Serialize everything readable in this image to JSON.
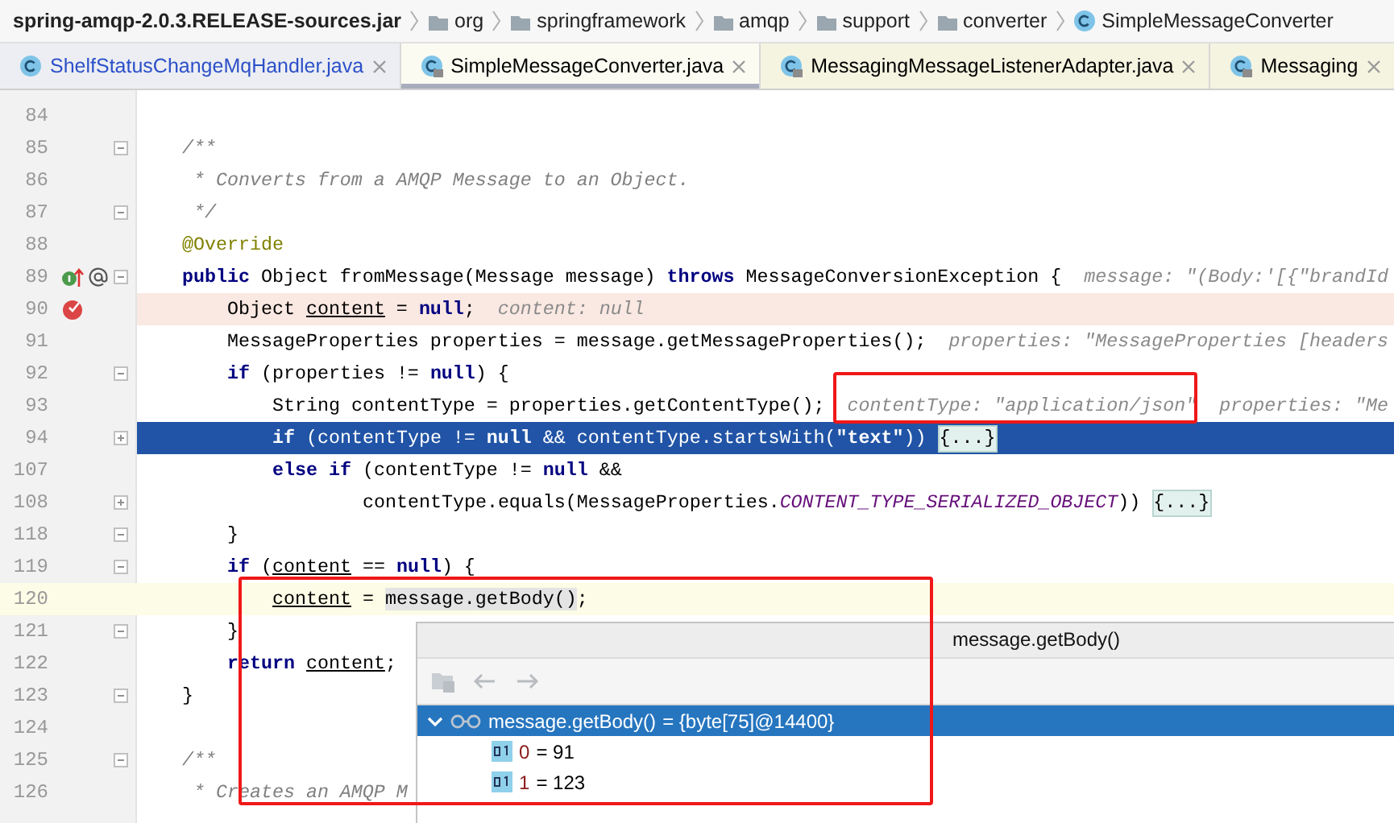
{
  "breadcrumbs": [
    {
      "kind": "jar",
      "label": "spring-amqp-2.0.3.RELEASE-sources.jar"
    },
    {
      "kind": "package",
      "label": "org"
    },
    {
      "kind": "package",
      "label": "springframework"
    },
    {
      "kind": "package",
      "label": "amqp"
    },
    {
      "kind": "package",
      "label": "support"
    },
    {
      "kind": "package",
      "label": "converter"
    },
    {
      "kind": "class",
      "label": "SimpleMessageConverter"
    }
  ],
  "tabs": [
    {
      "label": "ShelfStatusChangeMqHandler.java",
      "selected": false,
      "color": "#2c50c8",
      "library": false
    },
    {
      "label": "SimpleMessageConverter.java",
      "selected": true,
      "color": "#000000",
      "library": true
    },
    {
      "label": "MessagingMessageListenerAdapter.java",
      "selected": false,
      "color": "#000000",
      "library": true
    },
    {
      "label": "Messaging",
      "selected": false,
      "color": "#000000",
      "library": true
    }
  ],
  "editor": {
    "lines": [
      {
        "number": "84"
      },
      {
        "number": "85",
        "fold_marker": true,
        "collapsed": false,
        "segments": [
          {
            "kind": "comment",
            "s": "/**"
          }
        ]
      },
      {
        "number": "86",
        "segments": [
          {
            "kind": "comment",
            "s": " * Converts from a AMQP Message to an Object."
          }
        ]
      },
      {
        "number": "87",
        "fold_marker": true,
        "collapsed": false,
        "segments": [
          {
            "kind": "comment",
            "s": " */"
          }
        ]
      },
      {
        "number": "88",
        "segments": [
          {
            "kind": "annotation",
            "s": "@Override"
          }
        ]
      },
      {
        "number": "89",
        "fold_marker": true,
        "collapsed": false,
        "implements_marker": true,
        "annotation_marker": true,
        "segments": [
          {
            "kind": "keyword",
            "s": "public "
          },
          {
            "kind": "plain",
            "s": "Object fromMessage(Message message) "
          },
          {
            "kind": "keyword",
            "s": "throws "
          },
          {
            "kind": "plain",
            "s": "MessageConversionException {"
          },
          {
            "kind": "hint",
            "s": "message: \"(Body:'[{\"brandId"
          }
        ],
        "children": [
          {
            "number": "90",
            "breakpoint": true,
            "segments": [
              {
                "kind": "plain",
                "s": "Object "
              },
              {
                "kind": "variable",
                "s": "content"
              },
              {
                "kind": "plain",
                "s": " = "
              },
              {
                "kind": "keyword",
                "s": "null"
              },
              {
                "kind": "plain",
                "s": ";"
              },
              {
                "kind": "hint",
                "s": "content: null"
              }
            ]
          },
          {
            "number": "91",
            "segments": [
              {
                "kind": "plain",
                "s": "MessageProperties properties = message.getMessageProperties();"
              },
              {
                "kind": "hint",
                "s": "properties: \"MessageProperties [headers"
              }
            ]
          },
          {
            "number": "92",
            "fold_marker": true,
            "collapsed": false,
            "segments": [
              {
                "kind": "keyword",
                "s": "if "
              },
              {
                "kind": "plain",
                "s": "(properties != "
              },
              {
                "kind": "keyword",
                "s": "null"
              },
              {
                "kind": "plain",
                "s": ") {"
              }
            ],
            "children": [
              {
                "number": "93",
                "segments": [
                  {
                    "kind": "plain",
                    "s": "String contentType = properties.getContentType();"
                  },
                  {
                    "kind": "hint",
                    "s": "contentType: \"application/json\""
                  },
                  {
                    "kind": "hint",
                    "s": "properties: \"Me"
                  }
                ]
              },
              {
                "number": "94",
                "execution_point": true,
                "fold_marker": true,
                "collapsed": true,
                "segments": [
                  {
                    "kind": "keyword",
                    "s": "if "
                  },
                  {
                    "kind": "plain",
                    "s": "(contentType != "
                  },
                  {
                    "kind": "keyword",
                    "s": "null "
                  },
                  {
                    "kind": "plain",
                    "s": "&& contentType.startsWith("
                  },
                  {
                    "kind": "string",
                    "s": "\"text\""
                  },
                  {
                    "kind": "plain",
                    "s": ")) "
                  },
                  {
                    "kind": "folded",
                    "s": "{...}"
                  }
                ]
              },
              {
                "number": "107",
                "segments": [
                  {
                    "kind": "keyword",
                    "s": "else if "
                  },
                  {
                    "kind": "plain",
                    "s": "(contentType != "
                  },
                  {
                    "kind": "keyword",
                    "s": "null "
                  },
                  {
                    "kind": "plain",
                    "s": "&&"
                  }
                ],
                "children": [
                  {
                    "number": "108",
                    "continuation": true,
                    "fold_marker": true,
                    "collapsed": true,
                    "segments": [
                      {
                        "kind": "plain",
                        "s": "contentType.equals(MessageProperties."
                      },
                      {
                        "kind": "constant",
                        "s": "CONTENT_TYPE_SERIALIZED_OBJECT"
                      },
                      {
                        "kind": "plain",
                        "s": ")) "
                      },
                      {
                        "kind": "folded",
                        "s": "{...}"
                      }
                    ]
                  }
                ]
              }
            ]
          },
          {
            "number": "118",
            "fold_marker": true,
            "collapsed": false,
            "segments": [
              {
                "kind": "plain",
                "s": "}"
              }
            ]
          },
          {
            "number": "119",
            "fold_marker": true,
            "collapsed": false,
            "segments": [
              {
                "kind": "keyword",
                "s": "if "
              },
              {
                "kind": "plain",
                "s": "("
              },
              {
                "kind": "variable",
                "s": "content"
              },
              {
                "kind": "plain",
                "s": " == "
              },
              {
                "kind": "keyword",
                "s": "null"
              },
              {
                "kind": "plain",
                "s": ") {"
              }
            ],
            "children": [
              {
                "number": "120",
                "caret_line": true,
                "segments": [
                  {
                    "kind": "variable",
                    "s": "content"
                  },
                  {
                    "kind": "plain",
                    "s": " = "
                  },
                  {
                    "kind": "selection",
                    "s": "message.getBody()"
                  },
                  {
                    "kind": "plain",
                    "s": ";"
                  }
                ]
              }
            ]
          },
          {
            "number": "121",
            "fold_marker": true,
            "collapsed": false,
            "segments": [
              {
                "kind": "plain",
                "s": "}"
              }
            ]
          },
          {
            "number": "122",
            "segments": [
              {
                "kind": "keyword",
                "s": "return "
              },
              {
                "kind": "variable",
                "s": "content"
              },
              {
                "kind": "plain",
                "s": ";"
              }
            ]
          }
        ]
      },
      {
        "number": "123",
        "fold_marker": true,
        "collapsed": false,
        "segments": [
          {
            "kind": "plain",
            "s": "}"
          }
        ]
      },
      {
        "number": "124"
      },
      {
        "number": "125",
        "fold_marker": true,
        "collapsed": false,
        "segments": [
          {
            "kind": "comment",
            "s": "/**"
          }
        ]
      },
      {
        "number": "126",
        "segments": [
          {
            "kind": "comment",
            "s": " * Creates an AMQP M"
          }
        ]
      }
    ]
  },
  "evaluate_popup": {
    "title": "message.getBody()",
    "entries": [
      {
        "name": "message.getBody()",
        "value": "= {byte[75]@14400}",
        "selected": true,
        "expanded": true,
        "kind": "watch"
      },
      {
        "name": "0",
        "value": "= 91",
        "selected": false,
        "kind": "primitive"
      },
      {
        "name": "1",
        "value": "= 123",
        "selected": false,
        "kind": "primitive"
      }
    ]
  }
}
